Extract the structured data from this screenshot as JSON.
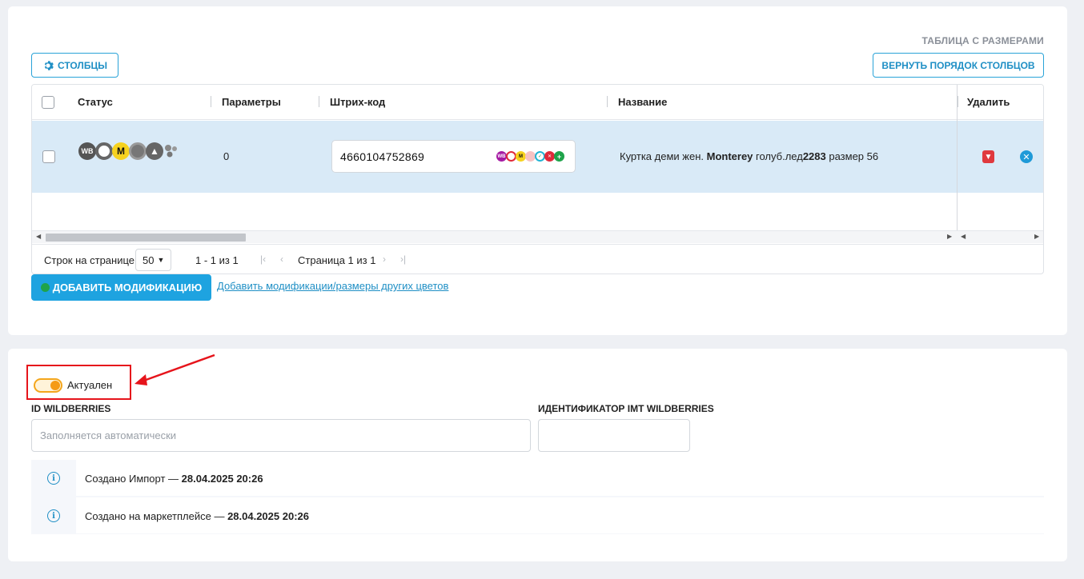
{
  "top_card": {
    "size_table_title": "ТАБЛИЦА С РАЗМЕРАМИ",
    "columns_button": "СТОЛБЦЫ",
    "reset_order_button": "ВЕРНУТЬ ПОРЯДОК СТОЛБЦОВ"
  },
  "grid": {
    "columns": [
      "Статус",
      "Параметры",
      "Штрих-код",
      "Название",
      "Удалить"
    ],
    "rows": [
      {
        "status_icons": [
          "WB",
          "Ozon",
          "Яндекс Маркет",
          "Мегамаркет",
          "Авито",
          "Другое"
        ],
        "params": "0",
        "barcode": "4660104752869",
        "name_prefix": "Куртка деми жен. ",
        "name_brand": "Monterey",
        "name_rest": " голуб.лед",
        "name_code": "2283",
        "name_size": " размер 56"
      }
    ]
  },
  "pager": {
    "rows_per_page_label": "Строк на странице",
    "rows_per_page_value": "50",
    "range": "1 - 1 из 1",
    "page": "Страница 1 из 1"
  },
  "actions": {
    "add_button": "ДОБАВИТЬ МОДИФИКАЦИЮ",
    "add_other_link": "Добавить модификации/размеры других цветов"
  },
  "bottom_card": {
    "toggle_label": "Актуален",
    "toggle_on": true,
    "wb_id_label": "ID WILDBERRIES",
    "wb_id_placeholder": "Заполняется автоматически",
    "wb_id_value": "",
    "imt_label": "ИДЕНТИФИКАТОР IMT WILDBERRIES",
    "imt_value": "",
    "history": [
      {
        "text": "Создано Импорт — ",
        "date": "28.04.2025 20:26"
      },
      {
        "text": "Создано на маркетплейсе — ",
        "date": "28.04.2025 20:26"
      }
    ]
  },
  "colors": {
    "accent": "#1ea3e0",
    "row_selected": "#d9eaf7",
    "toggle": "#f59b16",
    "annotation": "#e6141b",
    "delete": "#e0393e"
  }
}
